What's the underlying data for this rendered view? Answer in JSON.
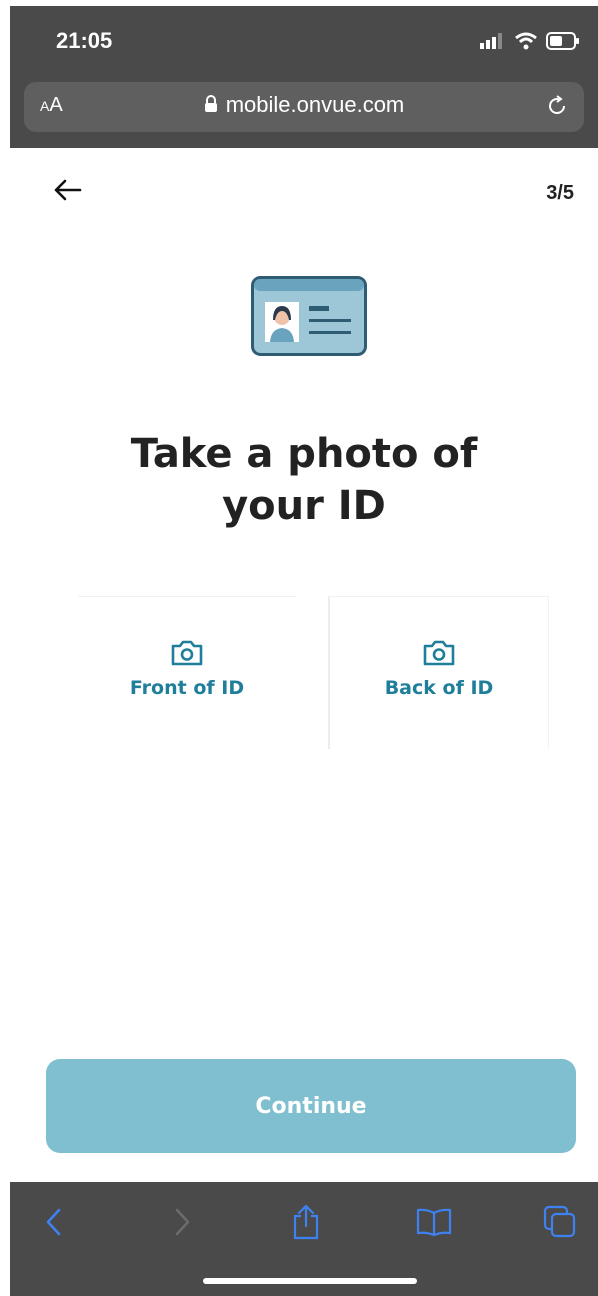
{
  "status_bar": {
    "time": "21:05",
    "signal_icon": "signal-bars-icon",
    "wifi_icon": "wifi-icon",
    "battery_icon": "battery-icon"
  },
  "browser": {
    "text_size_small": "A",
    "text_size_large": "A",
    "url": "mobile.onvue.com",
    "lock_icon": "lock-icon",
    "reload_icon": "reload-icon"
  },
  "page": {
    "back_icon": "arrow-left-icon",
    "step": "3/5",
    "illustration_icon": "id-card-icon",
    "heading_line1": "Take a photo of",
    "heading_line2": "your ID",
    "cards": [
      {
        "label": "Front of ID",
        "icon": "camera-icon"
      },
      {
        "label": "Back of ID",
        "icon": "camera-icon"
      }
    ],
    "continue_label": "Continue"
  },
  "toolbar": {
    "items": [
      "back-icon",
      "forward-icon",
      "share-icon",
      "bookmarks-icon",
      "tabs-icon"
    ]
  },
  "colors": {
    "chrome": "#4a4a4a",
    "accent": "#1f7f9a",
    "button": "#7fbfcf",
    "toolbar_icon": "#3d82f0"
  }
}
